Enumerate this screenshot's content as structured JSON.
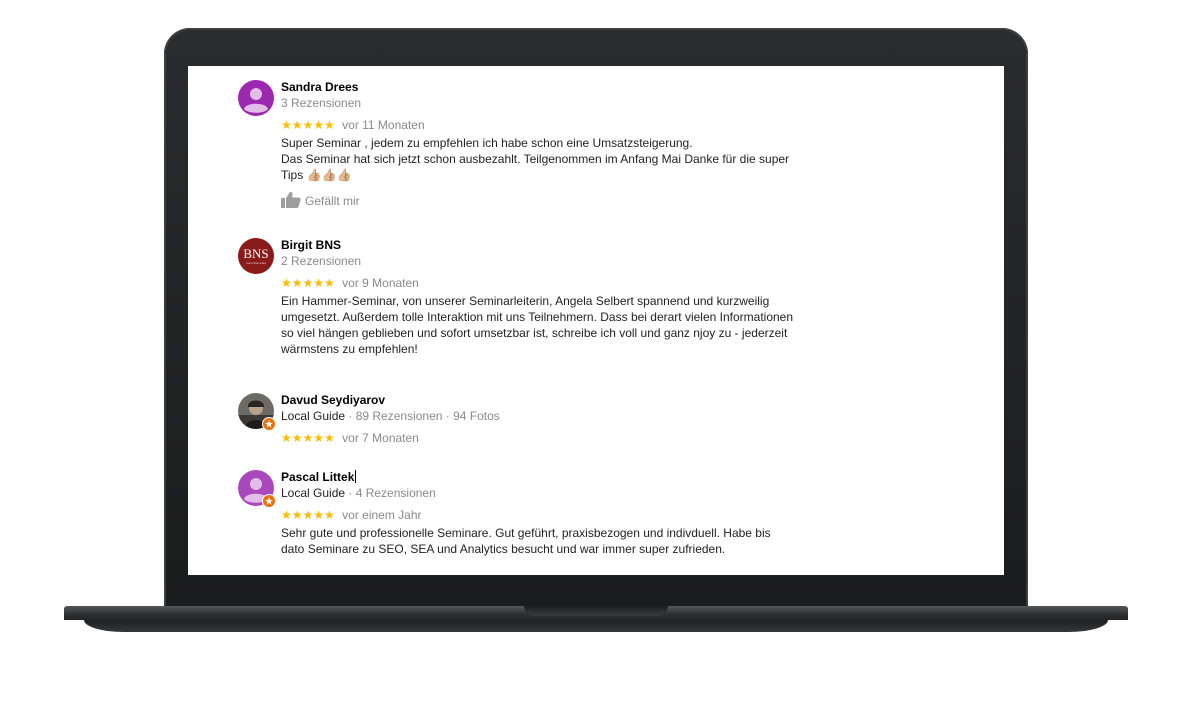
{
  "reviews": [
    {
      "name": "Sandra Drees",
      "meta": "3 Rezensionen",
      "stars": "★★★★★",
      "time": "vor 11 Monaten",
      "text": "Super Seminar , jedem zu empfehlen ich habe schon eine Umsatzsteigerung.\nDas Seminar hat sich jetzt schon ausbezahlt. Teilgenommen im Anfang Mai Danke für die super Tips 👍🏼👍🏼👍🏼",
      "like_label": "Gefällt mir",
      "avatar_color": "#9c27b0"
    },
    {
      "name": "Birgit BNS",
      "meta": "2 Rezensionen",
      "stars": "★★★★★",
      "time": "vor 9 Monaten",
      "text": "Ein Hammer-Seminar, von unserer Seminarleiterin, Angela Selbert spannend und kurzweilig umgesetzt. Außerdem tolle Interaktion mit uns Teilnehmern. Dass bei derart vielen Informationen so viel hängen geblieben und sofort umsetzbar ist, schreibe ich voll und ganz njoy zu - jederzeit wärmstens zu empfehlen!",
      "avatar_logo": "BNS",
      "avatar_logo_sub": "more than care",
      "avatar_color": "#8b1a1a"
    },
    {
      "name": "Davud Seydiyarov",
      "meta_guide": "Local Guide",
      "meta": " · 89 Rezensionen · 94 Fotos",
      "stars": "★★★★★",
      "time": "vor 7 Monaten"
    },
    {
      "name": "Pascal Littek",
      "meta_guide": "Local Guide",
      "meta": " · 4 Rezensionen",
      "stars": "★★★★★",
      "time": "vor einem Jahr",
      "text": "Sehr gute und professionelle Seminare. Gut geführt, praxisbezogen und indivduell. Habe bis dato Seminare zu SEO, SEA und Analytics besucht und war immer super zufrieden.",
      "avatar_color": "#ab47bc"
    }
  ],
  "colors": {
    "star": "#fbbc04",
    "guide_badge": "#e8710a"
  }
}
